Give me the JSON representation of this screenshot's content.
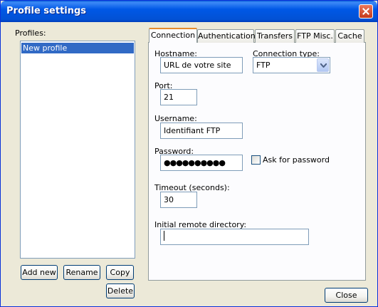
{
  "window": {
    "title": "Profile settings"
  },
  "profiles": {
    "label": "Profiles:",
    "items": [
      "New profile"
    ],
    "buttons": {
      "add_new": "Add new",
      "rename": "Rename",
      "copy": "Copy",
      "delete": "Delete"
    }
  },
  "tabs": [
    "Connection",
    "Authentication",
    "Transfers",
    "FTP Misc.",
    "Cache"
  ],
  "active_tab": "Connection",
  "connection": {
    "hostname_label": "Hostname:",
    "hostname_value": "URL de votre site",
    "connection_type_label": "Connection type:",
    "connection_type_value": "FTP",
    "port_label": "Port:",
    "port_value": "21",
    "username_label": "Username:",
    "username_value": "Identifiant FTP",
    "password_label": "Password:",
    "password_value": "●●●●●●●●●●",
    "ask_password_label": "Ask for password",
    "ask_password_checked": false,
    "timeout_label": "Timeout (seconds):",
    "timeout_value": "30",
    "initial_dir_label": "Initial remote directory:",
    "initial_dir_value": ""
  },
  "footer": {
    "close_label": "Close"
  }
}
